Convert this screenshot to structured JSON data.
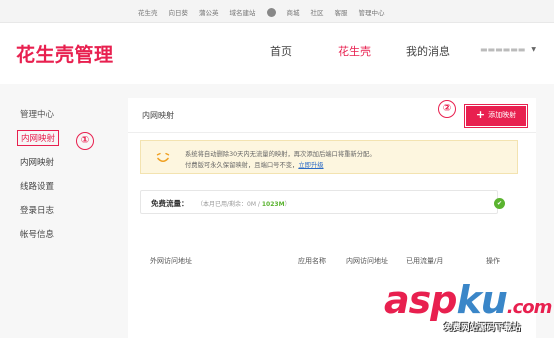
{
  "top_links": [
    "花生壳",
    "向日葵",
    "蒲公英",
    "域名建站",
    "商城",
    "社区",
    "客服",
    "管理中心"
  ],
  "header": {
    "logo": "花生壳管理",
    "nav": [
      "首页",
      "花生壳",
      "我的消息"
    ],
    "active_nav": "花生壳",
    "user": "▬▬▬▬▬▬",
    "brand_color": "#e8204f"
  },
  "sidebar": {
    "heading": "管理中心",
    "items": [
      "内网映射",
      "内网映射",
      "线路设置",
      "登录日志",
      "帐号信息"
    ],
    "active_index": 0
  },
  "annotations": [
    "①",
    "②"
  ],
  "content": {
    "title": "内网映射",
    "add_button": "添加映射",
    "notice": {
      "line1": "系统将自动删除30天内无流量的映射，再次添加后端口将重新分配。",
      "line2": "付费版可永久保留映射，且端口号不变，",
      "link": "立即升级"
    },
    "traffic": {
      "label": "免费流量：",
      "detail": "（本月已用/剩余：0M /",
      "quota": "1023M",
      "detail_end": "）"
    },
    "table_headers": [
      "外网访问地址",
      "应用名称",
      "内网访问地址",
      "已用流量/月",
      "操作"
    ]
  },
  "watermark": {
    "asp": "asp",
    "ku": "ku",
    "com": ".com",
    "sub": "免费网站源码下载站"
  }
}
